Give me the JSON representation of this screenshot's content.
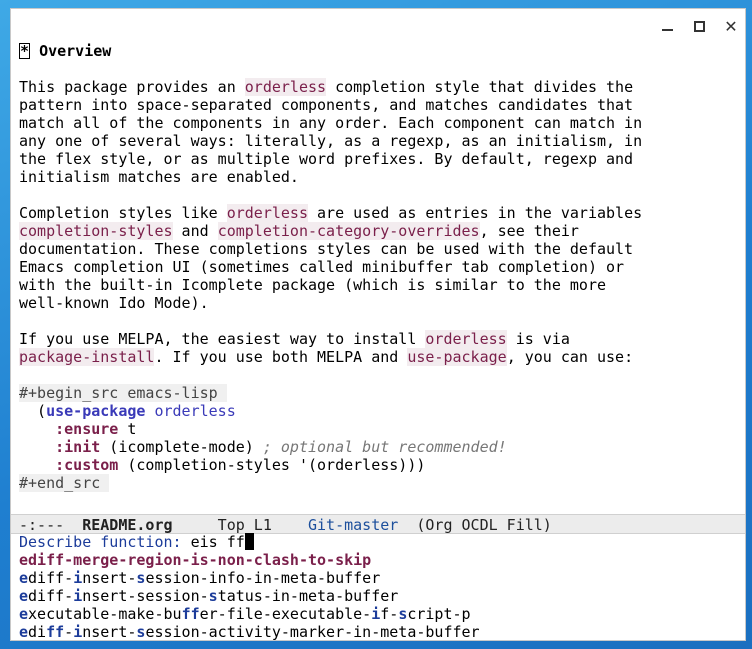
{
  "window": {
    "minimize_icon": "minimize-icon",
    "maximize_icon": "maximize-icon",
    "close_icon": "close-icon",
    "close_glyph": "✕"
  },
  "buffer": {
    "heading_star": "*",
    "heading_text": "Overview",
    "p1": {
      "l1a": "This package provides an ",
      "l1b": "orderless",
      "l1c": " completion style that divides the",
      "l2": "pattern into space-separated components, and matches candidates that",
      "l3": "match all of the components in any order. Each component can match in",
      "l4": "any one of several ways: literally, as a regexp, as an initialism, in",
      "l5": "the flex style, or as multiple word prefixes. By default, regexp and",
      "l6": "initialism matches are enabled."
    },
    "p2": {
      "l1a": "Completion styles like ",
      "l1b": "orderless",
      "l1c": " are used as entries in the variables",
      "l2a": "completion-styles",
      "l2b": " and ",
      "l2c": "completion-category-overrides",
      "l2d": ", see their",
      "l3": "documentation. These completions styles can be used with the default",
      "l4": "Emacs completion UI (sometimes called minibuffer tab completion) or",
      "l5": "with the built-in Icomplete package (which is similar to the more",
      "l6": "well-known Ido Mode)."
    },
    "p3": {
      "l1a": "If you use MELPA, the easiest way to install ",
      "l1b": "orderless",
      "l1c": " is via",
      "l2a": "package-install",
      "l2b": ". If you use both MELPA and ",
      "l2c": "use-package",
      "l2d": ", you can use:"
    },
    "src": {
      "begin": "#+begin_src emacs-lisp ",
      "l1a": "  (",
      "l1b": "use-package",
      "l1c": " ",
      "l1d": "orderless",
      "l2a": "    ",
      "l2b": ":ensure",
      "l2c": " t",
      "l3a": "    ",
      "l3b": ":init",
      "l3c": " (icomplete-mode) ",
      "l3d": "; optional but recommended!",
      "l4a": "    ",
      "l4b": ":custom",
      "l4c": " (completion-styles '(orderless)))",
      "end": "#+end_src "
    }
  },
  "modeline": {
    "status": "-:---  ",
    "buffer_name": "README.org",
    "position": "     Top L1    ",
    "branch": "Git-master",
    "modes": "  (Org OCDL Fill)"
  },
  "minibuffer": {
    "prompt": "Describe function: ",
    "input": "eis ff",
    "candidates": [
      {
        "text": "ediff-merge-region-is-non-clash-to-skip"
      },
      {
        "segments": [
          [
            "m",
            "e"
          ],
          [
            "n",
            "diff-"
          ],
          [
            "m",
            "i"
          ],
          [
            "n",
            "nsert-"
          ],
          [
            "m",
            "s"
          ],
          [
            "n",
            "ession-info-in-meta-buffer"
          ]
        ]
      },
      {
        "segments": [
          [
            "m",
            "e"
          ],
          [
            "n",
            "diff-"
          ],
          [
            "m",
            "i"
          ],
          [
            "n",
            "nsert-session-"
          ],
          [
            "m",
            "s"
          ],
          [
            "n",
            "tatus-in-meta-buffer"
          ]
        ]
      },
      {
        "segments": [
          [
            "m",
            "e"
          ],
          [
            "n",
            "xecutable-make-bu"
          ],
          [
            "m",
            "ff"
          ],
          [
            "n",
            "er-file-executable-"
          ],
          [
            "m",
            "i"
          ],
          [
            "n",
            "f-"
          ],
          [
            "m",
            "s"
          ],
          [
            "n",
            "cript-p"
          ]
        ]
      },
      {
        "segments": [
          [
            "m",
            "e"
          ],
          [
            "n",
            "di"
          ],
          [
            "m",
            "ff"
          ],
          [
            "n",
            "-"
          ],
          [
            "m",
            "i"
          ],
          [
            "n",
            "nsert-"
          ],
          [
            "m",
            "s"
          ],
          [
            "n",
            "ession-activity-marker-in-meta-buffer"
          ]
        ]
      }
    ]
  }
}
